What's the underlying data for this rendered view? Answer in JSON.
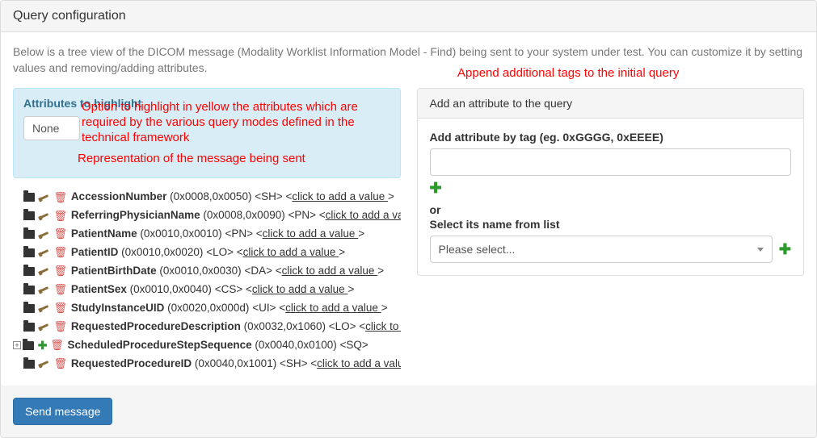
{
  "panel": {
    "title": "Query configuration",
    "intro": "Below is a tree view of the DICOM message (Modality Worklist Information Model - Find) being sent to your system under test. You can customize it by setting values and removing/adding attributes."
  },
  "highlight": {
    "title": "Attributes to highlight",
    "selected": "None"
  },
  "tree": {
    "click_to_add": "click to add a value",
    "items": [
      {
        "name": "AccessionNumber",
        "tag": "(0x0008,0x0050)",
        "vr": "SH",
        "editable": true,
        "expandable": false
      },
      {
        "name": "ReferringPhysicianName",
        "tag": "(0x0008,0x0090)",
        "vr": "PN",
        "editable": true,
        "expandable": false
      },
      {
        "name": "PatientName",
        "tag": "(0x0010,0x0010)",
        "vr": "PN",
        "editable": true,
        "expandable": false
      },
      {
        "name": "PatientID",
        "tag": "(0x0010,0x0020)",
        "vr": "LO",
        "editable": true,
        "expandable": false
      },
      {
        "name": "PatientBirthDate",
        "tag": "(0x0010,0x0030)",
        "vr": "DA",
        "editable": true,
        "expandable": false
      },
      {
        "name": "PatientSex",
        "tag": "(0x0010,0x0040)",
        "vr": "CS",
        "editable": true,
        "expandable": false
      },
      {
        "name": "StudyInstanceUID",
        "tag": "(0x0020,0x000d)",
        "vr": "UI",
        "editable": true,
        "expandable": false
      },
      {
        "name": "RequestedProcedureDescription",
        "tag": "(0x0032,0x1060)",
        "vr": "LO",
        "editable": true,
        "expandable": false
      },
      {
        "name": "ScheduledProcedureStepSequence",
        "tag": "(0x0040,0x0100)",
        "vr": "SQ",
        "editable": false,
        "expandable": true
      },
      {
        "name": "RequestedProcedureID",
        "tag": "(0x0040,0x1001)",
        "vr": "SH",
        "editable": true,
        "expandable": false
      }
    ]
  },
  "add_panel": {
    "heading": "Add an attribute to the query",
    "by_tag_label": "Add attribute by tag (eg. 0xGGGG, 0xEEEE)",
    "or": "or",
    "select_label": "Select its name from list",
    "select_placeholder": "Please select..."
  },
  "annotations": {
    "append": "Append additional tags to the initial query",
    "highlight_note": "Option to highlight in yellow the attributes which are required by the various query modes defined in the technical framework",
    "representation": "Representation of the message being sent"
  },
  "buttons": {
    "send": "Send message"
  }
}
